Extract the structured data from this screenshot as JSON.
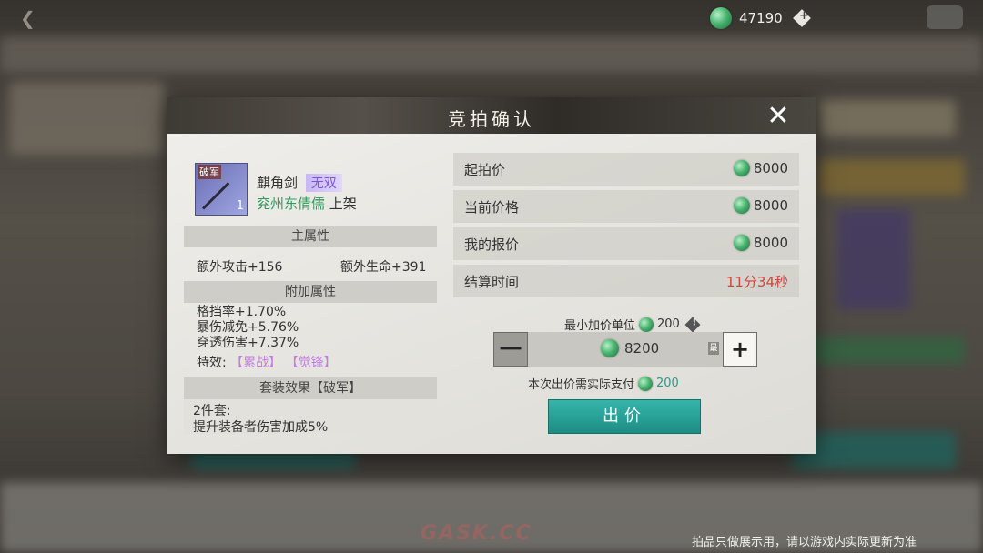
{
  "topbar": {
    "back_icon": "back-arrow-icon",
    "currency_icon": "jade-coin-icon",
    "currency_amount": "47190",
    "add_currency_icon": "plus-diamond-icon"
  },
  "dialog": {
    "title": "竞拍确认",
    "close_icon": "close-x-icon",
    "item": {
      "tag": "破军",
      "count": "1",
      "name": "麒角剑",
      "rarity": "无双",
      "seller": "兖州东倩儒",
      "seller_suffix": "上架"
    },
    "main_attr": {
      "header": "主属性",
      "left": "额外攻击+156",
      "right": "额外生命+391"
    },
    "extra_attr": {
      "header": "附加属性",
      "lines": [
        "格挡率+1.70%",
        "暴伤减免+5.76%",
        "穿透伤害+7.37%"
      ],
      "effect_label": "特效:",
      "effects": [
        "【累战】",
        "【觉锋】"
      ]
    },
    "set_effect": {
      "header": "套装效果【破军】",
      "line1": "2件套:",
      "line2": "提升装备者伤害加成5%"
    },
    "prices": {
      "start_label": "起拍价",
      "start_value": "8000",
      "current_label": "当前价格",
      "current_value": "8000",
      "mybid_label": "我的报价",
      "mybid_value": "8000",
      "time_label": "结算时间",
      "time_value": "11分34秒"
    },
    "min_increment_label": "最小加价单位",
    "min_increment_value": "200",
    "stepper": {
      "minus": "一",
      "value": "8200",
      "max_tag": "最",
      "plus": "+"
    },
    "pay_label": "本次出价需实际支付",
    "pay_value": "200",
    "bid_button": "出价"
  },
  "footer_note": "拍品只做展示用，请以游戏内实际更新为准",
  "watermark": "GASK.CC",
  "colors": {
    "accent_teal": "#2aa59b",
    "time_red": "#d0453d",
    "seller_green": "#2f9a5c",
    "rarity_purple": "#7b56d6"
  }
}
